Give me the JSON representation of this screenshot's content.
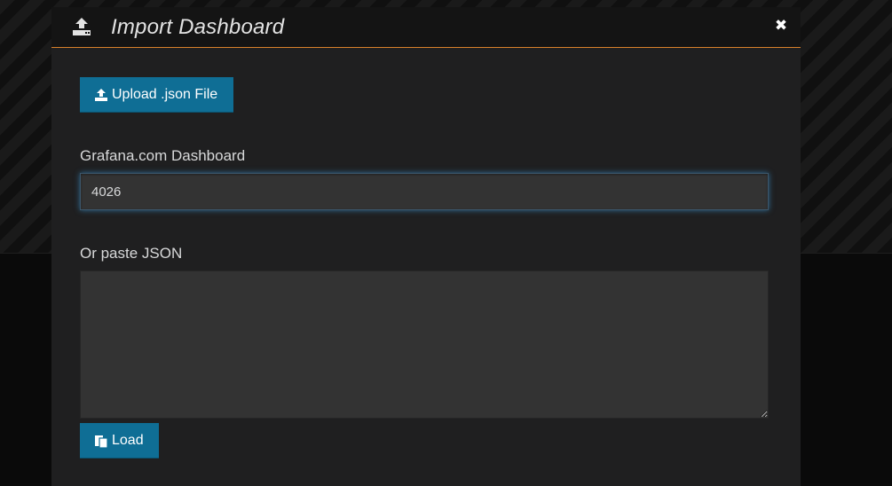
{
  "modal": {
    "title": "Import Dashboard",
    "close_icon": "close-icon",
    "header_icon": "upload-icon"
  },
  "upload_button": {
    "label": "Upload .json File",
    "icon": "upload-icon"
  },
  "grafana_com": {
    "label": "Grafana.com Dashboard",
    "value": "4026"
  },
  "paste_json": {
    "label": "Or paste JSON",
    "value": ""
  },
  "load_button": {
    "label": "Load",
    "icon": "paste-icon"
  },
  "colors": {
    "accent": "#d9822b",
    "primary_button": "#0f6e95",
    "input_background": "#333333",
    "modal_background": "#1f1f20"
  }
}
